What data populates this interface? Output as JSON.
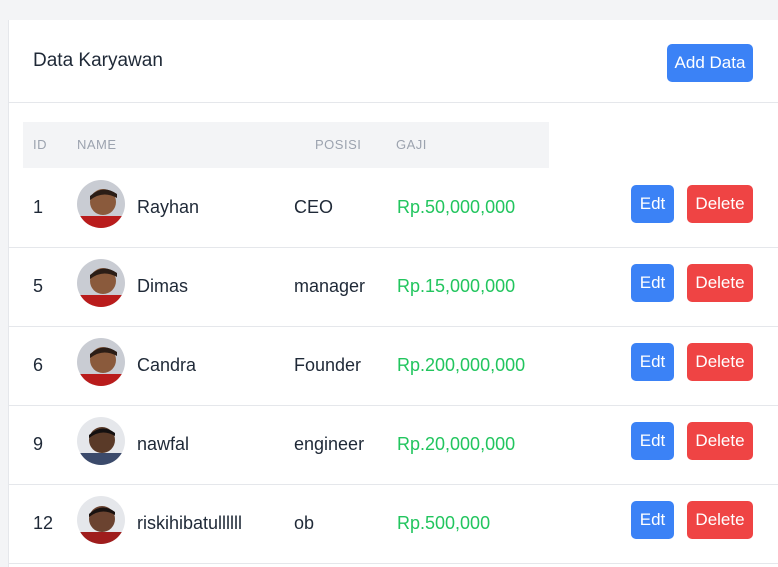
{
  "header": {
    "title": "Data Karyawan",
    "add_label": "Add Data"
  },
  "table": {
    "columns": [
      "ID",
      "NAME",
      "POSISI",
      "GAJI"
    ],
    "rows": [
      {
        "id": "1",
        "name": "Rayhan",
        "posisi": "CEO",
        "gaji": "Rp.50,000,000",
        "edit_label": "Edt",
        "delete_label": "Delete"
      },
      {
        "id": "5",
        "name": "Dimas",
        "posisi": "manager",
        "gaji": "Rp.15,000,000",
        "edit_label": "Edt",
        "delete_label": "Delete"
      },
      {
        "id": "6",
        "name": "Candra",
        "posisi": "Founder",
        "gaji": "Rp.200,000,000",
        "edit_label": "Edt",
        "delete_label": "Delete"
      },
      {
        "id": "9",
        "name": "nawfal",
        "posisi": "engineer",
        "gaji": "Rp.20,000,000",
        "edit_label": "Edt",
        "delete_label": "Delete"
      },
      {
        "id": "12",
        "name": "riskihibatullllll",
        "posisi": "ob",
        "gaji": "Rp.500,000",
        "edit_label": "Edt",
        "delete_label": "Delete"
      }
    ]
  },
  "colors": {
    "primary": "#3b82f6",
    "danger": "#ef4444",
    "salary": "#22c55e"
  }
}
